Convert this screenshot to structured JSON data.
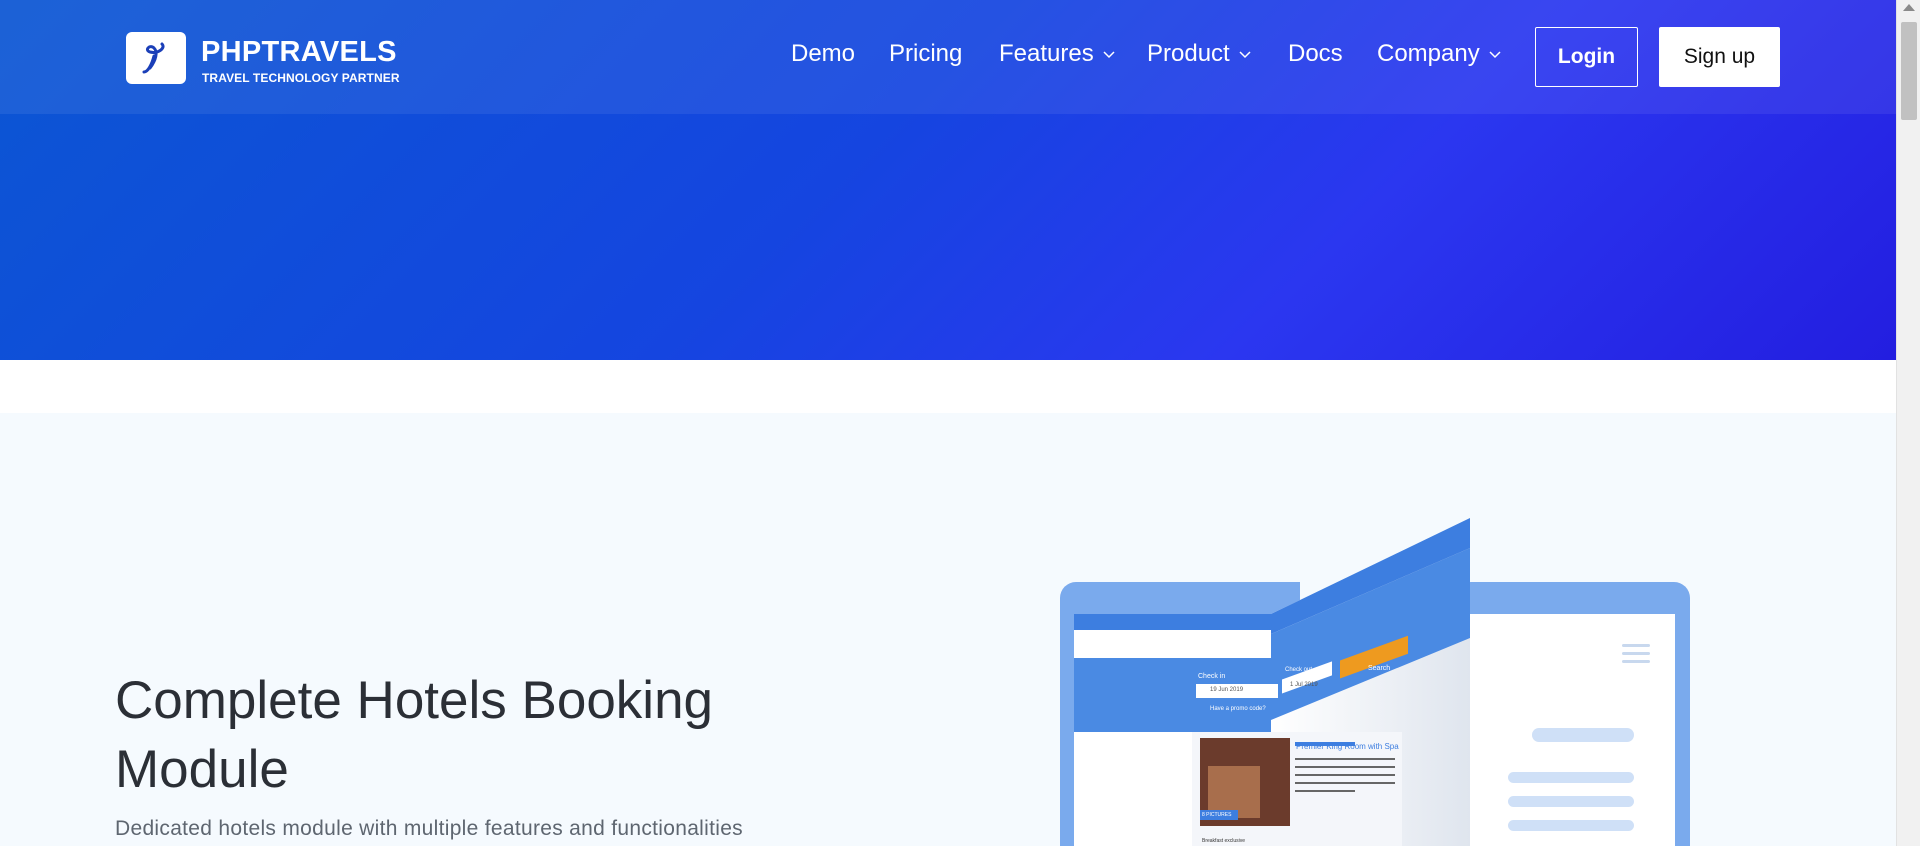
{
  "brand": {
    "name": "PHPTRAVELS",
    "tagline": "TRAVEL TECHNOLOGY PARTNER",
    "logo_icon": "script-p-logo-icon"
  },
  "nav": {
    "items": [
      {
        "label": "Demo",
        "has_dropdown": false
      },
      {
        "label": "Pricing",
        "has_dropdown": false
      },
      {
        "label": "Features",
        "has_dropdown": true
      },
      {
        "label": "Product",
        "has_dropdown": true
      },
      {
        "label": "Docs",
        "has_dropdown": false
      },
      {
        "label": "Company",
        "has_dropdown": true
      }
    ],
    "login_label": "Login",
    "signup_label": "Sign up"
  },
  "hero_section": {
    "title": "Complete Hotels Booking Module",
    "subtitle": "Dedicated hotels module with multiple features and functionalities"
  },
  "illustration": {
    "search": {
      "checkin_label": "Check in",
      "checkin_value": "19 Jun 2019",
      "checkout_label": "Check out",
      "checkout_value": "1 Jul 2019",
      "search_button": "Search",
      "promo_link": "Have a promo code?"
    },
    "listing": {
      "room_title": "Premier King Room with Spa",
      "pictures_badge": "8 PICTURES",
      "feature": "Breakfast exclusive"
    }
  },
  "colors": {
    "hero_start": "#0b56d3",
    "hero_end": "#231ee0",
    "section_bg": "#f5fafe",
    "accent_orange": "#ee9a1f"
  }
}
